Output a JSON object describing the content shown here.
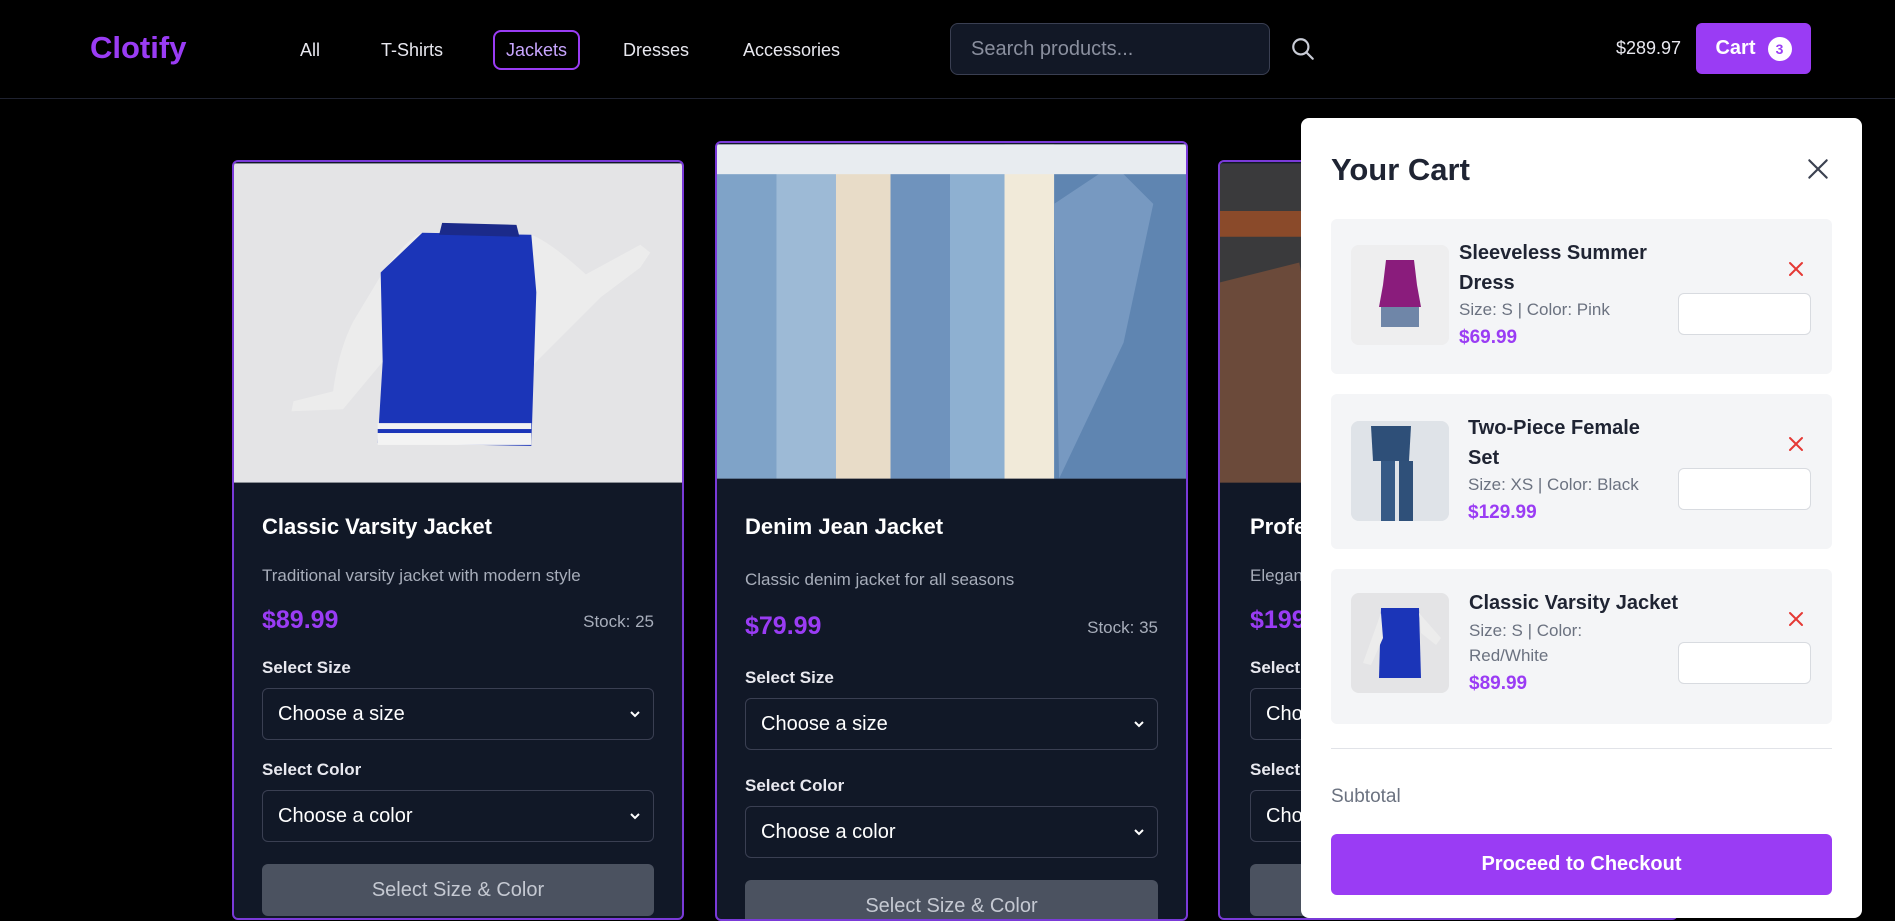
{
  "brand": {
    "name": "Clotify",
    "accent": "#9a3cf4"
  },
  "nav": {
    "items": [
      {
        "label": "All"
      },
      {
        "label": "T-Shirts"
      },
      {
        "label": "Jackets",
        "active": true
      },
      {
        "label": "Dresses"
      },
      {
        "label": "Accessories"
      }
    ]
  },
  "search": {
    "placeholder": "Search products..."
  },
  "header": {
    "total": "$289.97",
    "cart_label": "Cart",
    "cart_count": "3"
  },
  "products": [
    {
      "title": "Classic Varsity Jacket",
      "description": "Traditional varsity jacket with modern style",
      "price": "$89.99",
      "stock": "Stock: 25",
      "size_label": "Select Size",
      "size_value": "Choose a size",
      "color_label": "Select Color",
      "color_value": "Choose a color",
      "button_label": "Select Size & Color"
    },
    {
      "title": "Denim Jean Jacket",
      "description": "Classic denim jacket for all seasons",
      "price": "$79.99",
      "stock": "Stock: 35",
      "size_label": "Select Size",
      "size_value": "Choose a size",
      "color_label": "Select Color",
      "color_value": "Choose a color",
      "button_label": "Select Size & Color"
    },
    {
      "title": "Profe",
      "description": "Elegan",
      "price": "$199",
      "size_label": "Select",
      "size_value": "Cho",
      "color_label": "Select",
      "color_value": "Cho"
    }
  ],
  "cart": {
    "title": "Your Cart",
    "items": [
      {
        "name": "Sleeveless Summer Dress",
        "meta": "Size: S | Color: Pink",
        "price": "$69.99"
      },
      {
        "name": "Two-Piece Female Set",
        "meta": "Size: XS | Color: Black",
        "price": "$129.99"
      },
      {
        "name": "Classic Varsity Jacket",
        "meta": "Size: S | Color: Red/White",
        "price": "$89.99"
      }
    ],
    "subtotal_label": "Subtotal",
    "checkout_label": "Proceed to Checkout"
  }
}
